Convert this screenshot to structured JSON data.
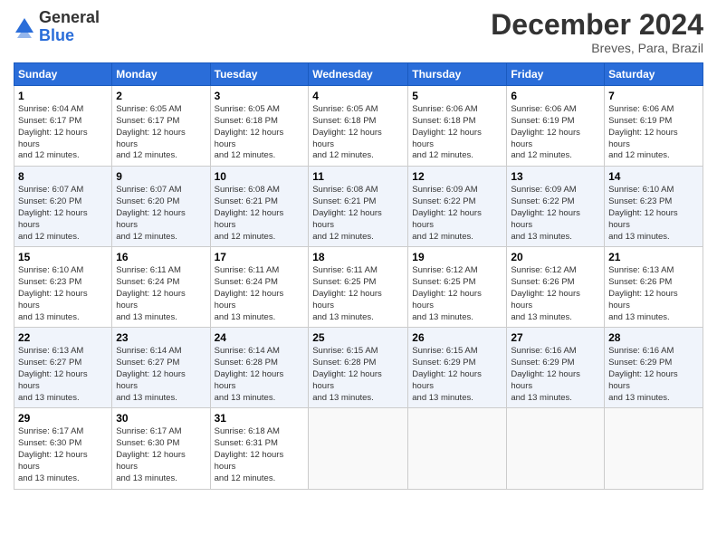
{
  "header": {
    "logo_general": "General",
    "logo_blue": "Blue",
    "month_title": "December 2024",
    "location": "Breves, Para, Brazil"
  },
  "days_of_week": [
    "Sunday",
    "Monday",
    "Tuesday",
    "Wednesday",
    "Thursday",
    "Friday",
    "Saturday"
  ],
  "weeks": [
    [
      {
        "day": "1",
        "sunrise": "6:04 AM",
        "sunset": "6:17 PM",
        "daylight": "12 hours and 12 minutes."
      },
      {
        "day": "2",
        "sunrise": "6:05 AM",
        "sunset": "6:17 PM",
        "daylight": "12 hours and 12 minutes."
      },
      {
        "day": "3",
        "sunrise": "6:05 AM",
        "sunset": "6:18 PM",
        "daylight": "12 hours and 12 minutes."
      },
      {
        "day": "4",
        "sunrise": "6:05 AM",
        "sunset": "6:18 PM",
        "daylight": "12 hours and 12 minutes."
      },
      {
        "day": "5",
        "sunrise": "6:06 AM",
        "sunset": "6:18 PM",
        "daylight": "12 hours and 12 minutes."
      },
      {
        "day": "6",
        "sunrise": "6:06 AM",
        "sunset": "6:19 PM",
        "daylight": "12 hours and 12 minutes."
      },
      {
        "day": "7",
        "sunrise": "6:06 AM",
        "sunset": "6:19 PM",
        "daylight": "12 hours and 12 minutes."
      }
    ],
    [
      {
        "day": "8",
        "sunrise": "6:07 AM",
        "sunset": "6:20 PM",
        "daylight": "12 hours and 12 minutes."
      },
      {
        "day": "9",
        "sunrise": "6:07 AM",
        "sunset": "6:20 PM",
        "daylight": "12 hours and 12 minutes."
      },
      {
        "day": "10",
        "sunrise": "6:08 AM",
        "sunset": "6:21 PM",
        "daylight": "12 hours and 12 minutes."
      },
      {
        "day": "11",
        "sunrise": "6:08 AM",
        "sunset": "6:21 PM",
        "daylight": "12 hours and 12 minutes."
      },
      {
        "day": "12",
        "sunrise": "6:09 AM",
        "sunset": "6:22 PM",
        "daylight": "12 hours and 12 minutes."
      },
      {
        "day": "13",
        "sunrise": "6:09 AM",
        "sunset": "6:22 PM",
        "daylight": "12 hours and 13 minutes."
      },
      {
        "day": "14",
        "sunrise": "6:10 AM",
        "sunset": "6:23 PM",
        "daylight": "12 hours and 13 minutes."
      }
    ],
    [
      {
        "day": "15",
        "sunrise": "6:10 AM",
        "sunset": "6:23 PM",
        "daylight": "12 hours and 13 minutes."
      },
      {
        "day": "16",
        "sunrise": "6:11 AM",
        "sunset": "6:24 PM",
        "daylight": "12 hours and 13 minutes."
      },
      {
        "day": "17",
        "sunrise": "6:11 AM",
        "sunset": "6:24 PM",
        "daylight": "12 hours and 13 minutes."
      },
      {
        "day": "18",
        "sunrise": "6:11 AM",
        "sunset": "6:25 PM",
        "daylight": "12 hours and 13 minutes."
      },
      {
        "day": "19",
        "sunrise": "6:12 AM",
        "sunset": "6:25 PM",
        "daylight": "12 hours and 13 minutes."
      },
      {
        "day": "20",
        "sunrise": "6:12 AM",
        "sunset": "6:26 PM",
        "daylight": "12 hours and 13 minutes."
      },
      {
        "day": "21",
        "sunrise": "6:13 AM",
        "sunset": "6:26 PM",
        "daylight": "12 hours and 13 minutes."
      }
    ],
    [
      {
        "day": "22",
        "sunrise": "6:13 AM",
        "sunset": "6:27 PM",
        "daylight": "12 hours and 13 minutes."
      },
      {
        "day": "23",
        "sunrise": "6:14 AM",
        "sunset": "6:27 PM",
        "daylight": "12 hours and 13 minutes."
      },
      {
        "day": "24",
        "sunrise": "6:14 AM",
        "sunset": "6:28 PM",
        "daylight": "12 hours and 13 minutes."
      },
      {
        "day": "25",
        "sunrise": "6:15 AM",
        "sunset": "6:28 PM",
        "daylight": "12 hours and 13 minutes."
      },
      {
        "day": "26",
        "sunrise": "6:15 AM",
        "sunset": "6:29 PM",
        "daylight": "12 hours and 13 minutes."
      },
      {
        "day": "27",
        "sunrise": "6:16 AM",
        "sunset": "6:29 PM",
        "daylight": "12 hours and 13 minutes."
      },
      {
        "day": "28",
        "sunrise": "6:16 AM",
        "sunset": "6:29 PM",
        "daylight": "12 hours and 13 minutes."
      }
    ],
    [
      {
        "day": "29",
        "sunrise": "6:17 AM",
        "sunset": "6:30 PM",
        "daylight": "12 hours and 13 minutes."
      },
      {
        "day": "30",
        "sunrise": "6:17 AM",
        "sunset": "6:30 PM",
        "daylight": "12 hours and 13 minutes."
      },
      {
        "day": "31",
        "sunrise": "6:18 AM",
        "sunset": "6:31 PM",
        "daylight": "12 hours and 12 minutes."
      },
      null,
      null,
      null,
      null
    ]
  ]
}
